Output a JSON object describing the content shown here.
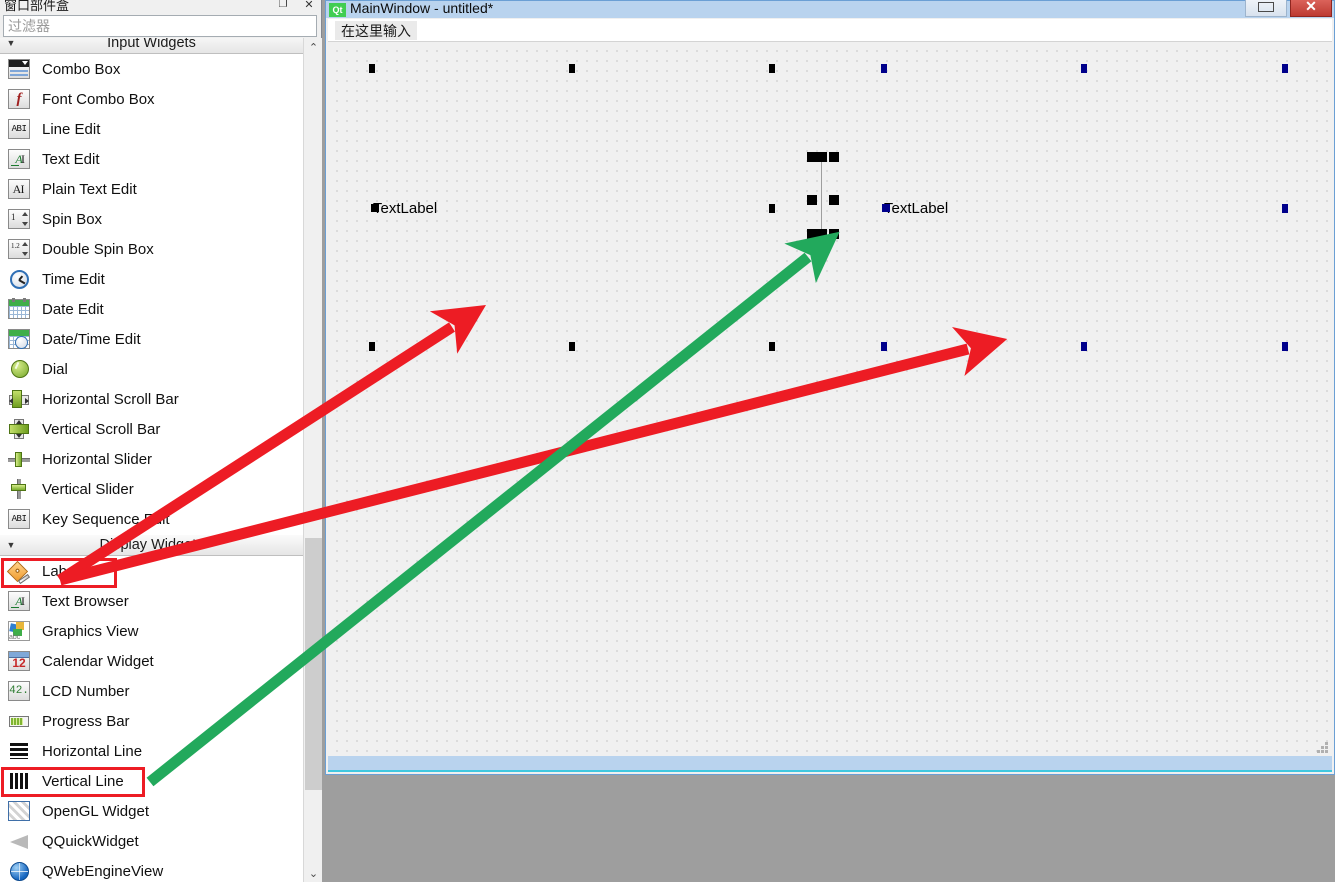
{
  "widget_box": {
    "title": "窗口部件盒",
    "float_icon": "float-icon",
    "close_icon": "close-icon",
    "filter_placeholder": "过滤器",
    "filter_value": "",
    "scroll_up_icon": "chevron-up-icon",
    "scroll_down_icon": "chevron-down-icon",
    "sections": [
      {
        "label": "Input Widgets",
        "arrow": "chevron-down-icon",
        "expanded": true,
        "items": [
          {
            "label": "Combo Box",
            "icon": "combo-box-icon"
          },
          {
            "label": "Font Combo Box",
            "icon": "font-combo-box-icon"
          },
          {
            "label": "Line Edit",
            "icon": "line-edit-icon"
          },
          {
            "label": "Text Edit",
            "icon": "text-edit-icon"
          },
          {
            "label": "Plain Text Edit",
            "icon": "plain-text-edit-icon"
          },
          {
            "label": "Spin Box",
            "icon": "spin-box-icon"
          },
          {
            "label": "Double Spin Box",
            "icon": "double-spin-box-icon"
          },
          {
            "label": "Time Edit",
            "icon": "time-edit-icon"
          },
          {
            "label": "Date Edit",
            "icon": "date-edit-icon"
          },
          {
            "label": "Date/Time Edit",
            "icon": "date-time-edit-icon"
          },
          {
            "label": "Dial",
            "icon": "dial-icon"
          },
          {
            "label": "Horizontal Scroll Bar",
            "icon": "horizontal-scroll-bar-icon"
          },
          {
            "label": "Vertical Scroll Bar",
            "icon": "vertical-scroll-bar-icon"
          },
          {
            "label": "Horizontal Slider",
            "icon": "horizontal-slider-icon"
          },
          {
            "label": "Vertical Slider",
            "icon": "vertical-slider-icon"
          },
          {
            "label": "Key Sequence Edit",
            "icon": "key-sequence-edit-icon"
          }
        ]
      },
      {
        "label": "Display Widgets",
        "arrow": "chevron-down-icon",
        "expanded": true,
        "items": [
          {
            "label": "Label",
            "icon": "label-icon",
            "highlighted": true
          },
          {
            "label": "Text Browser",
            "icon": "text-browser-icon"
          },
          {
            "label": "Graphics View",
            "icon": "graphics-view-icon"
          },
          {
            "label": "Calendar Widget",
            "icon": "calendar-widget-icon"
          },
          {
            "label": "LCD Number",
            "icon": "lcd-number-icon"
          },
          {
            "label": "Progress Bar",
            "icon": "progress-bar-icon"
          },
          {
            "label": "Horizontal Line",
            "icon": "horizontal-line-icon"
          },
          {
            "label": "Vertical Line",
            "icon": "vertical-line-icon",
            "highlighted": true
          },
          {
            "label": "OpenGL Widget",
            "icon": "opengl-widget-icon"
          },
          {
            "label": "QQuickWidget",
            "icon": "qquickwidget-icon"
          },
          {
            "label": "QWebEngineView",
            "icon": "qwebengineview-icon"
          }
        ]
      }
    ]
  },
  "main_window": {
    "logo_text": "Qt",
    "title": "MainWindow - untitled*",
    "restore_button_icon": "restore-icon",
    "close_button_label": "✕",
    "menubar_placeholder": "在这里输入",
    "canvas": {
      "labels": [
        {
          "text": "TextLabel",
          "handle_color": "#000000"
        },
        {
          "text": "TextLabel",
          "handle_color": "#00008b"
        }
      ],
      "selected_widget": "vertical-line",
      "size_grip_icon": "resize-grip-icon"
    }
  },
  "annotations": {
    "red_color": "#ED1C24",
    "green_color": "#22A95C",
    "arrows": [
      {
        "color": "#ED1C24",
        "from_label": "Label",
        "to": "left-text-label-area"
      },
      {
        "color": "#ED1C24",
        "from_label": "Label",
        "to": "right-text-label-area"
      },
      {
        "color": "#22A95C",
        "from_label": "Vertical Line",
        "to": "selected-vertical-line"
      }
    ],
    "highlight_boxes": [
      "Label",
      "Vertical Line"
    ]
  }
}
